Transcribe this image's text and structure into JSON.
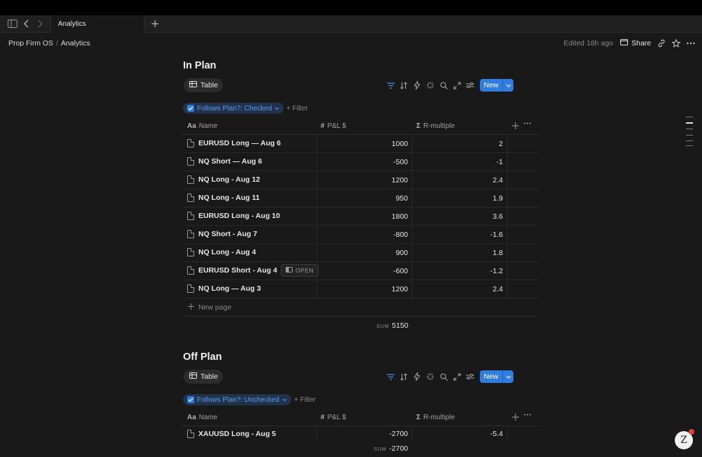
{
  "tab": {
    "title": "Analytics"
  },
  "breadcrumb": {
    "root": "Prop Firm OS",
    "sep": "/",
    "current": "Analytics"
  },
  "header": {
    "edited": "Edited 18h ago",
    "share": "Share"
  },
  "in_plan": {
    "title": "In Plan",
    "view_label": "Table",
    "new_label": "New",
    "filter_label": "Follows Plan?: Checked",
    "add_filter": "+ Filter",
    "columns": {
      "name": "Name",
      "pnl": "P&L $",
      "r": "R-multiple",
      "name_sym": "Aa",
      "pnl_sym": "#",
      "r_sym": "Σ"
    },
    "rows": [
      {
        "name": "EURUSD Long — Aug 6",
        "pnl": "1000",
        "r": "2"
      },
      {
        "name": "NQ Short — Aug 6",
        "pnl": "-500",
        "r": "-1"
      },
      {
        "name": "NQ Long - Aug 12",
        "pnl": "1200",
        "r": "2.4"
      },
      {
        "name": "NQ Long - Aug 11",
        "pnl": "950",
        "r": "1.9"
      },
      {
        "name": "EURUSD Long - Aug 10",
        "pnl": "1800",
        "r": "3.6"
      },
      {
        "name": "NQ Short - Aug 7",
        "pnl": "-800",
        "r": "-1.6"
      },
      {
        "name": "NQ Long - Aug 4",
        "pnl": "900",
        "r": "1.8"
      },
      {
        "name": "EURUSD Short - Aug 4",
        "pnl": "-600",
        "r": "-1.2",
        "badge": "OPEN"
      },
      {
        "name": "NQ Long — Aug 3",
        "pnl": "1200",
        "r": "2.4"
      }
    ],
    "new_page": "New page",
    "sum_label": "SUM",
    "sum_value": "5150"
  },
  "off_plan": {
    "title": "Off Plan",
    "view_label": "Table",
    "new_label": "New",
    "filter_label": "Follows Plan?: Unchecked",
    "add_filter": "+ Filter",
    "columns": {
      "name": "Name",
      "pnl": "P&L $",
      "r": "R-multiple",
      "name_sym": "Aa",
      "pnl_sym": "#",
      "r_sym": "Σ"
    },
    "rows": [
      {
        "name": "XAUUSD Long - Aug 5",
        "pnl": "-2700",
        "r": "-5.4"
      }
    ],
    "sum_label": "SUM",
    "sum_value": "-2700"
  },
  "avatar": {
    "letter": "Z"
  },
  "colors": {
    "accent": "#2f7de0",
    "bg": "#191919",
    "filter_text": "#5b9cf2"
  }
}
